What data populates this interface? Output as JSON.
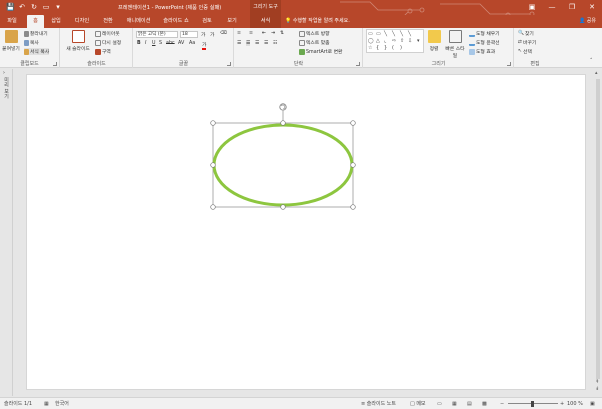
{
  "titlebar": {
    "doc_title": "프레젠테이션1 - PowerPoint (제품 인증 실패)",
    "context_tools": "그리기 도구",
    "qat_icons": [
      "save-icon",
      "undo-icon",
      "redo-icon",
      "present-icon",
      "customize-icon"
    ],
    "window_buttons": [
      "ribbon-display-icon",
      "minimize-icon",
      "restore-icon",
      "close-icon"
    ]
  },
  "tabs": [
    {
      "label": "파일"
    },
    {
      "label": "홈",
      "active": true
    },
    {
      "label": "삽입"
    },
    {
      "label": "디자인"
    },
    {
      "label": "전환"
    },
    {
      "label": "애니메이션"
    },
    {
      "label": "슬라이드 쇼"
    },
    {
      "label": "검토"
    },
    {
      "label": "보기"
    },
    {
      "label": "서식",
      "contextual": true
    }
  ],
  "tell_me": "수행할 작업을 알려 주세요.",
  "share": "공유",
  "ribbon": {
    "clipboard": {
      "label": "클립보드",
      "paste": "붙여넣기",
      "cut": "잘라내기",
      "copy": "복사",
      "format_painter": "서식 복사"
    },
    "slides": {
      "label": "슬라이드",
      "new_slide": "새 슬라이드",
      "layout": "레이아웃",
      "reset": "다시 설정",
      "section": "구역"
    },
    "font": {
      "label": "글꼴",
      "font_name": "맑은 고딕 (본)",
      "font_size": "18",
      "buttons": [
        "가",
        "가",
        "B",
        "I",
        "U",
        "S",
        "abc",
        "AV",
        "Aa",
        "가"
      ],
      "font_color_label": "가"
    },
    "paragraph": {
      "label": "단락",
      "text_direction": "텍스트 방향",
      "align_text": "텍스트 맞춤",
      "smartart": "SmartArt로 변환"
    },
    "drawing": {
      "label": "그리기",
      "arrange": "정렬",
      "quick_styles": "빠른 스타일",
      "shape_fill": "도형 채우기",
      "shape_outline": "도형 윤곽선",
      "shape_effects": "도형 효과"
    },
    "editing": {
      "label": "편집",
      "find": "찾기",
      "replace": "바꾸기",
      "select": "선택"
    }
  },
  "left_pane": {
    "label": "미리 보기"
  },
  "statusbar": {
    "slide_count": "슬라이드 1/1",
    "language": "한국어",
    "notes": "슬라이드 노트",
    "comments": "메모",
    "zoom": "100 %"
  },
  "colors": {
    "accent": "#b7472a",
    "ellipse_stroke": "#8dc63f"
  }
}
